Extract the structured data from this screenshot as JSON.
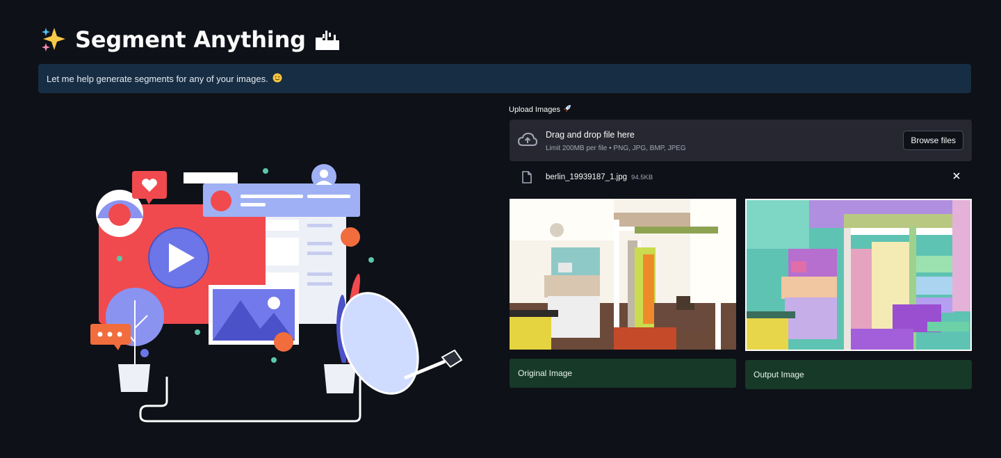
{
  "header": {
    "title": "Segment Anything",
    "title_icon_left": "sparkles-icon",
    "title_icon_right": "desert-landscape-icon"
  },
  "info": {
    "message": "Let me help generate segments for any of your images.",
    "emoji": "wink-face-icon"
  },
  "uploader": {
    "label": "Upload Images",
    "label_icon": "rocket-icon",
    "drop_title": "Drag and drop file here",
    "drop_subtitle": "Limit 200MB per file • PNG, JPG, BMP, JPEG",
    "browse_label": "Browse files"
  },
  "file": {
    "name": "berlin_19939187_1.jpg",
    "size": "94.5KB"
  },
  "results": {
    "original_caption": "Original Image",
    "output_caption": "Output Image"
  },
  "colors": {
    "background": "#0e1117",
    "info_bg": "#172d43",
    "dropzone_bg": "#262730",
    "caption_bg": "#173928"
  }
}
